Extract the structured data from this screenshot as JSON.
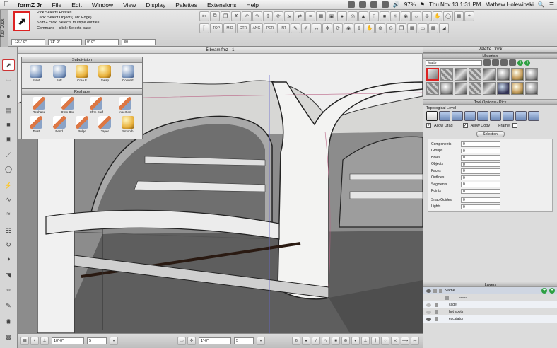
{
  "menubar": {
    "app_name": "formZ Jr",
    "items": [
      "File",
      "Edit",
      "Window",
      "View",
      "Display",
      "Palettes",
      "Extensions",
      "Help"
    ],
    "battery": "97%",
    "clock": "Thu Nov 13  1:31 PM",
    "user": "Mathew Holewinski"
  },
  "toolbar": {
    "tool_dock_label": "Tool Dock",
    "hints": [
      "Pick   Selects Entities",
      "Click: Select Object (Tab: Edge)",
      "Shift + click: Selects multiple entities",
      "Command + click: Selects base"
    ],
    "coords": [
      "-121'-0\"",
      "71'-0\"",
      "0'-0\"",
      "30"
    ]
  },
  "viewport": {
    "title": "5 beam.fmz - 1"
  },
  "subdivision_palette": {
    "title": "Subdivision",
    "items": [
      "Subd",
      "Soft",
      "Crea F",
      "Swap",
      "Convert"
    ]
  },
  "reshape_palette": {
    "title": "Reshape",
    "row1": [
      "Reshape",
      "Dfrm Box",
      "Dfrm Surf",
      "Insertion"
    ],
    "row2": [
      "Twist",
      "Bend",
      "Bulge",
      "Taper",
      "Smooth"
    ]
  },
  "palette_dock": {
    "title": "Palette Dock",
    "materials": {
      "title": "Materials",
      "selected": "Matte"
    },
    "tool_options": {
      "title": "Tool Options - Pick",
      "topological_label": "Topological Level",
      "allow_drag": "Allow Drag",
      "allow_copy": "Allow Copy",
      "frame": "Frame",
      "selection_button": "Selection",
      "counts": [
        {
          "label": "Components",
          "value": "0"
        },
        {
          "label": "Groups",
          "value": "0"
        },
        {
          "label": "Holes",
          "value": "0"
        },
        {
          "label": "Objects",
          "value": "0"
        },
        {
          "label": "Faces",
          "value": "0"
        },
        {
          "label": "Outlines",
          "value": "0"
        },
        {
          "label": "Segments",
          "value": "0"
        },
        {
          "label": "Points",
          "value": "0"
        }
      ],
      "extra_counts": [
        {
          "label": "Snap Guides",
          "value": "0"
        },
        {
          "label": "Lights",
          "value": "0"
        }
      ]
    },
    "layers": {
      "title": "Layers",
      "column": "Name",
      "rows": [
        "------",
        "cage",
        "hot spots",
        "escalator"
      ]
    }
  },
  "bottombar": {
    "fields": [
      "10'-0\"",
      "5",
      "1'-0\"",
      "5"
    ]
  }
}
